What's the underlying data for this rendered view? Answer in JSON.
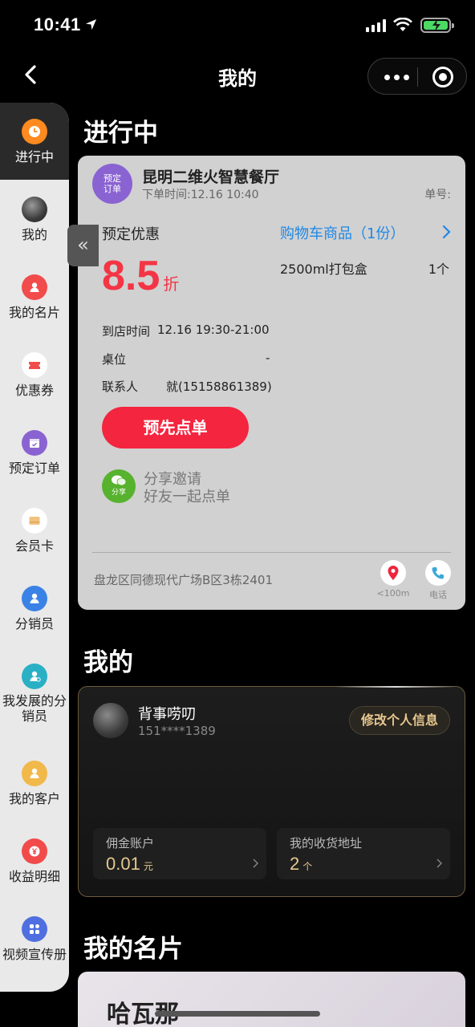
{
  "status_bar": {
    "time": "10:41"
  },
  "nav": {
    "title": "我的"
  },
  "sidebar": {
    "items": [
      {
        "label": "进行中",
        "icon": "clock-icon",
        "color": "#ff8a1f",
        "active": true
      },
      {
        "label": "我的",
        "icon": "avatar-icon",
        "color": "#444"
      },
      {
        "label": "我的名片",
        "icon": "person-card-icon",
        "color": "#f24b4b"
      },
      {
        "label": "优惠券",
        "icon": "ticket-icon",
        "color": "#f24b4b"
      },
      {
        "label": "预定订单",
        "icon": "calendar-icon",
        "color": "#8a63d2"
      },
      {
        "label": "会员卡",
        "icon": "card-icon",
        "color": "#f1c27d"
      },
      {
        "label": "分销员",
        "icon": "user-icon",
        "color": "#3b82e6"
      },
      {
        "label": "我发展的分销员",
        "icon": "users-icon",
        "color": "#2ab0c5"
      },
      {
        "label": "我的客户",
        "icon": "customer-icon",
        "color": "#f1b84a"
      },
      {
        "label": "收益明细",
        "icon": "yen-icon",
        "color": "#f24b4b"
      },
      {
        "label": "视频宣传册",
        "icon": "grid-icon",
        "color": "#4f6fe0"
      }
    ]
  },
  "in_progress": {
    "section_title": "进行中",
    "badge_text": "预定订单",
    "shop_name": "昆明二维火智慧餐厅",
    "order_time": "下单时间:12.16 10:40",
    "order_no_label": "单号:",
    "promo_label": "预定优惠",
    "discount_value": "8.5",
    "discount_unit": "折",
    "cart_link": "购物车商品（1份）",
    "cart_items": [
      {
        "name": "2500ml打包盒",
        "qty": "1个"
      }
    ],
    "arrival_label": "到店时间",
    "arrival_value": "12.16 19:30-21:00",
    "table_label": "桌位",
    "table_value": "-",
    "contact_label": "联系人",
    "contact_value": "就(15158861389)",
    "preorder_button": "预先点单",
    "share_icon_text": "分享",
    "share_line1": "分享邀请",
    "share_line2": "好友一起点单",
    "address": "盘龙区同德现代广场B区3栋2401",
    "location_label": "<100m",
    "phone_label": "电话"
  },
  "profile": {
    "section_title": "我的",
    "name": "背事唠叨",
    "phone": "151****1389",
    "edit_button": "修改个人信息",
    "commission_label": "佣金账户",
    "commission_value": "0.01",
    "commission_unit": "元",
    "address_label": "我的收货地址",
    "address_value": "2",
    "address_unit": "个"
  },
  "card_section": {
    "section_title": "我的名片",
    "card_name": "哈瓦那"
  }
}
